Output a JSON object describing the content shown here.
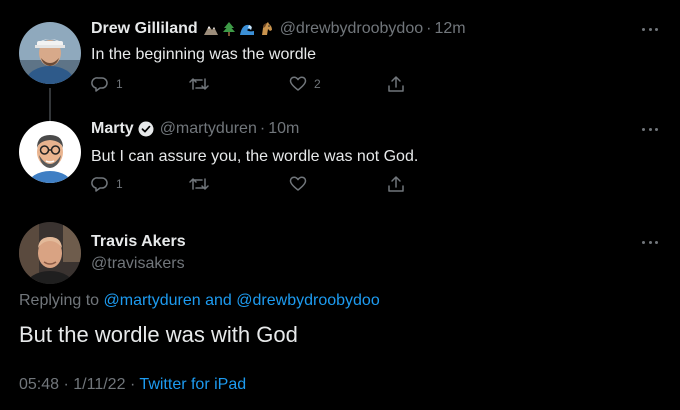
{
  "tweets": [
    {
      "name": "Drew Gilliland",
      "name_emoji": [
        "mountain-emoji",
        "tree-emoji",
        "wave-emoji",
        "horse-emoji"
      ],
      "handle": "@drewbydroobydoo",
      "separator": "·",
      "time": "12m",
      "text": "In the beginning was the wordle",
      "reply_count": "1",
      "retweet_count": "",
      "like_count": "2"
    },
    {
      "name": "Marty",
      "verified": true,
      "handle": "@martyduren",
      "separator": "·",
      "time": "10m",
      "text": "But I can assure you, the wordle was not God.",
      "reply_count": "1",
      "retweet_count": "",
      "like_count": ""
    }
  ],
  "focused": {
    "name": "Travis Akers",
    "handle": "@travisakers",
    "replying_prefix": "Replying to",
    "reply_user_1": "@martyduren",
    "reply_and": "and",
    "reply_user_2": "@drewbydroobydoo",
    "text": "But the wordle was with God",
    "time": "05:48",
    "date_sep": "·",
    "date": "1/11/22",
    "source_sep": "·",
    "source": "Twitter for iPad"
  },
  "colors": {
    "background": "#000000",
    "text": "#e7e9ea",
    "secondary": "#71767b",
    "link": "#1d9bf0",
    "thread_line": "#333639"
  }
}
